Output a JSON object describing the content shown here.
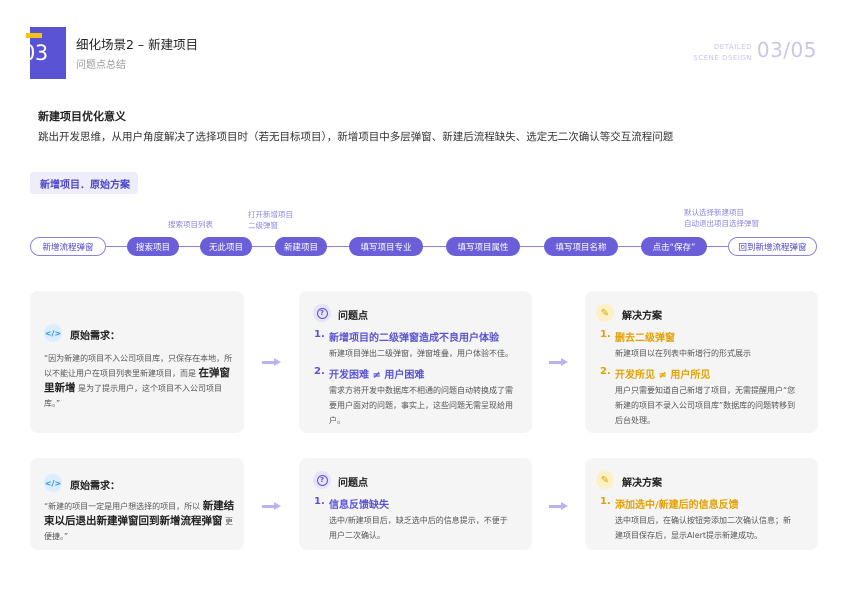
{
  "header": {
    "num": "03",
    "title": "细化场景2 – 新建项目",
    "subtitle": "问题点总结",
    "detailed_line1": "DETAILED",
    "detailed_line2": "SCENE DSEIGN",
    "page_num": "03/05"
  },
  "meaning": {
    "title": "新建项目优化意义",
    "text": "跳出开发思维，从用户角度解决了选择项目时（若无目标项目），新增项目中多层弹窗、新建后流程缺失、选定无二次确认等交互流程问题"
  },
  "section": {
    "tag": "新增项目．原始方案"
  },
  "flow": {
    "nodes": [
      "新增流程弹窗",
      "搜索项目",
      "无此项目",
      "新建项目",
      "填写项目专业",
      "填写项目属性",
      "填写项目名称",
      "点击“保存”",
      "回到新增流程弹窗"
    ],
    "notes": {
      "search": "搜索项目列表",
      "open_line1": "打开新增项目",
      "open_line2": "二级弹窗",
      "default_line1": "默认选择新建项目",
      "default_line2": "自动退出项目选择弹窗"
    }
  },
  "row1": {
    "need": {
      "title": "原始需求：",
      "text_before": "“因为新建的项目不入公司项目库，只保存在本地，所以不能让用户在项目列表里新建项目，而是 ",
      "text_bold": "在弹窗里新增",
      "text_after": " 是为了提示用户，这个项目不入公司项目库。”"
    },
    "problem": {
      "title": "问题点",
      "items": [
        {
          "num": "1.",
          "title": "新增项目的二级弹窗造成不良用户体验",
          "desc": "新建项目弹出二级弹窗，弹窗堆叠，用户体验不佳。"
        },
        {
          "num": "2.",
          "title": "开发困难 ≠ 用户困难",
          "desc": "需求方将开发中数据库不相通的问题自动转换成了需要用户面对的问题，事实上，这些问题无需呈现给用户。"
        }
      ]
    },
    "solution": {
      "title": "解决方案",
      "items": [
        {
          "num": "1.",
          "title": "删去二级弹窗",
          "desc": "新建项目以在列表中新增行的形式展示"
        },
        {
          "num": "2.",
          "title": "开发所见 ≠ 用户所见",
          "desc": "用户只需要知道自己新增了项目，无需提醒用户“您新建的项目不录入公司项目库”数据库的问题转移到后台处理。"
        }
      ]
    }
  },
  "row2": {
    "need": {
      "title": "原始需求：",
      "text_before": "“新建的项目一定是用户想选择的项目，所以 ",
      "text_bold": "新建结束以后退出新建弹窗回到新增流程弹窗",
      "text_after": " 更便捷。”"
    },
    "problem": {
      "title": "问题点",
      "items": [
        {
          "num": "1.",
          "title": "信息反馈缺失",
          "desc": "选中/新建项目后，缺乏选中后的信息提示，不便于用户二次确认。"
        }
      ]
    },
    "solution": {
      "title": "解决方案",
      "items": [
        {
          "num": "1.",
          "title": "添加选中/新建后的信息反馈",
          "desc": "选中项目后，在确认按钮旁添加二次确认信息；新建项目保存后，显示Alert提示新建成功。"
        }
      ]
    }
  },
  "icons": {
    "code": "code-icon",
    "question": "question-circle-icon",
    "pen": "edit-pen-icon",
    "arrow": "arrow-right-icon"
  },
  "colors": {
    "accent": "#5a54d4",
    "highlight": "#f2c21b",
    "card_bg": "#f5f5f5",
    "flow_line": "#8a84e0"
  }
}
